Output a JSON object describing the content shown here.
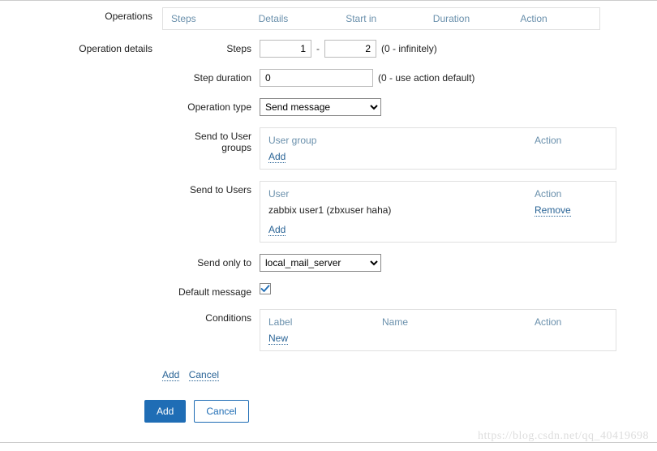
{
  "labels": {
    "operations": "Operations",
    "operation_details": "Operation details",
    "steps": "Steps",
    "step_duration": "Step duration",
    "operation_type": "Operation type",
    "send_to_user_groups": "Send to User groups",
    "send_to_users": "Send to Users",
    "send_only_to": "Send only to",
    "default_message": "Default message",
    "conditions": "Conditions"
  },
  "operations_table": {
    "cols": [
      "Steps",
      "Details",
      "Start in",
      "Duration",
      "Action"
    ]
  },
  "details": {
    "steps_from": "1",
    "steps_to": "2",
    "steps_hint": "(0 - infinitely)",
    "step_duration_value": "0",
    "step_duration_hint": "(0 - use action default)",
    "operation_type_value": "Send message",
    "send_only_to_value": "local_mail_server",
    "default_message_checked": true
  },
  "user_groups_box": {
    "col1": "User group",
    "col2": "Action",
    "add": "Add"
  },
  "users_box": {
    "col1": "User",
    "col2": "Action",
    "row1_user": "zabbix user1 (zbxuser haha)",
    "row1_action": "Remove",
    "add": "Add"
  },
  "conditions_box": {
    "col1": "Label",
    "col2": "Name",
    "col3": "Action",
    "new": "New"
  },
  "inline": {
    "add": "Add",
    "cancel": "Cancel"
  },
  "buttons": {
    "add": "Add",
    "cancel": "Cancel"
  },
  "watermark": "https://blog.csdn.net/qq_40419698"
}
